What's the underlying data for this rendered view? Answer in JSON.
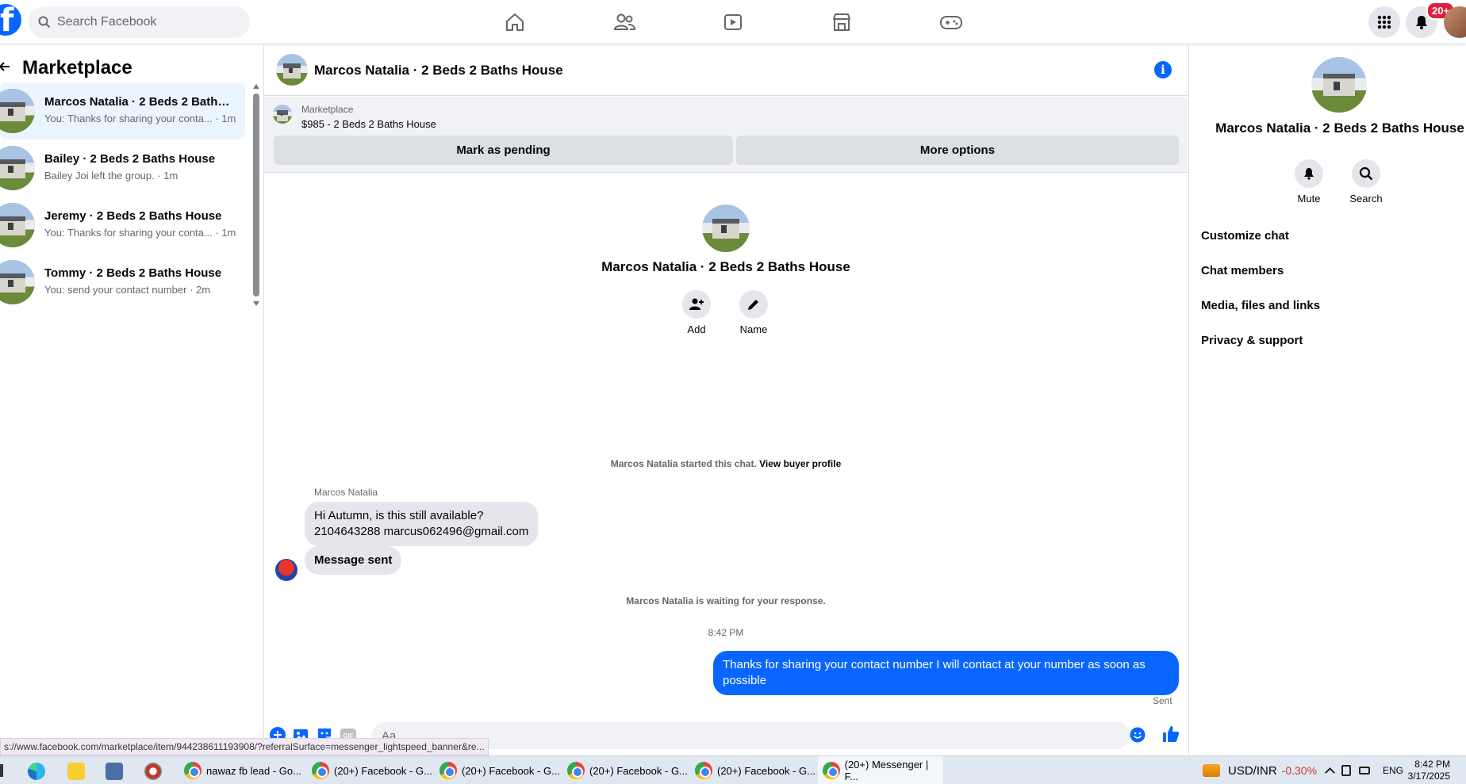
{
  "topbar": {
    "logo": "f",
    "search_placeholder": "Search Facebook",
    "nav_icons": [
      "home-icon",
      "friends-icon",
      "watch-icon",
      "marketplace-icon",
      "gaming-icon"
    ],
    "notifications_badge": "20+"
  },
  "sidebar": {
    "title": "Marketplace",
    "conversations": [
      {
        "name": "Marcos Natalia · 2 Beds 2 Baths ...",
        "preview": "You: Thanks for sharing your conta... · 1m",
        "selected": true
      },
      {
        "name": "Bailey · 2 Beds 2 Baths House",
        "preview": "Bailey Joi left the group. · 1m",
        "selected": false
      },
      {
        "name": "Jeremy · 2 Beds 2 Baths House",
        "preview": "You: Thanks for sharing your conta... · 1m",
        "selected": false
      },
      {
        "name": "Tommy · 2 Beds 2 Baths House",
        "preview": "You: send your contact number · 2m",
        "selected": false
      }
    ]
  },
  "chat": {
    "title": "Marcos Natalia · 2 Beds 2 Baths House",
    "marketplace": {
      "label": "Marketplace",
      "price_listing": "$985 - 2 Beds 2 Baths House",
      "mark_pending": "Mark as pending",
      "more_options": "More options"
    },
    "intro": {
      "name": "Marcos Natalia · 2 Beds 2 Baths House",
      "add_label": "Add",
      "name_label": "Name"
    },
    "started_text": "Marcos Natalia started this chat.",
    "view_buyer": "View buyer profile",
    "sender_name": "Marcos Natalia",
    "incoming": [
      {
        "line1": "Hi Autumn, is this still available?",
        "line2": "2104643288 marcus062496@gmail.com"
      },
      {
        "line1": "Message sent"
      }
    ],
    "waiting_text": "Marcos Natalia is waiting for your response.",
    "timestamp": "8:42 PM",
    "outgoing": "Thanks for sharing your contact number I will contact at your number as soon as possible",
    "sent_status": "Sent",
    "compose_placeholder": "Aa"
  },
  "details": {
    "name": "Marcos Natalia · 2 Beds 2 Baths House",
    "mute": "Mute",
    "search": "Search",
    "menu": [
      "Customize chat",
      "Chat members",
      "Media, files and links",
      "Privacy & support"
    ]
  },
  "status_url": "s://www.facebook.com/marketplace/item/944238611193908/?referralSurface=messenger_lightspeed_banner&re...",
  "taskbar": {
    "tasks": [
      "nawaz fb lead - Go...",
      "(20+) Facebook - G...",
      "(20+) Facebook - G...",
      "(20+) Facebook - G...",
      "(20+) Facebook - G...",
      "(20+) Messenger | F..."
    ],
    "currency": "USD/INR",
    "change": "-0.30%",
    "lang": "ENG",
    "time": "8:42 PM",
    "date": "3/17/2025"
  },
  "colors": {
    "accent": "#0866ff",
    "badge": "#e41e3f",
    "negative": "#d13438"
  }
}
